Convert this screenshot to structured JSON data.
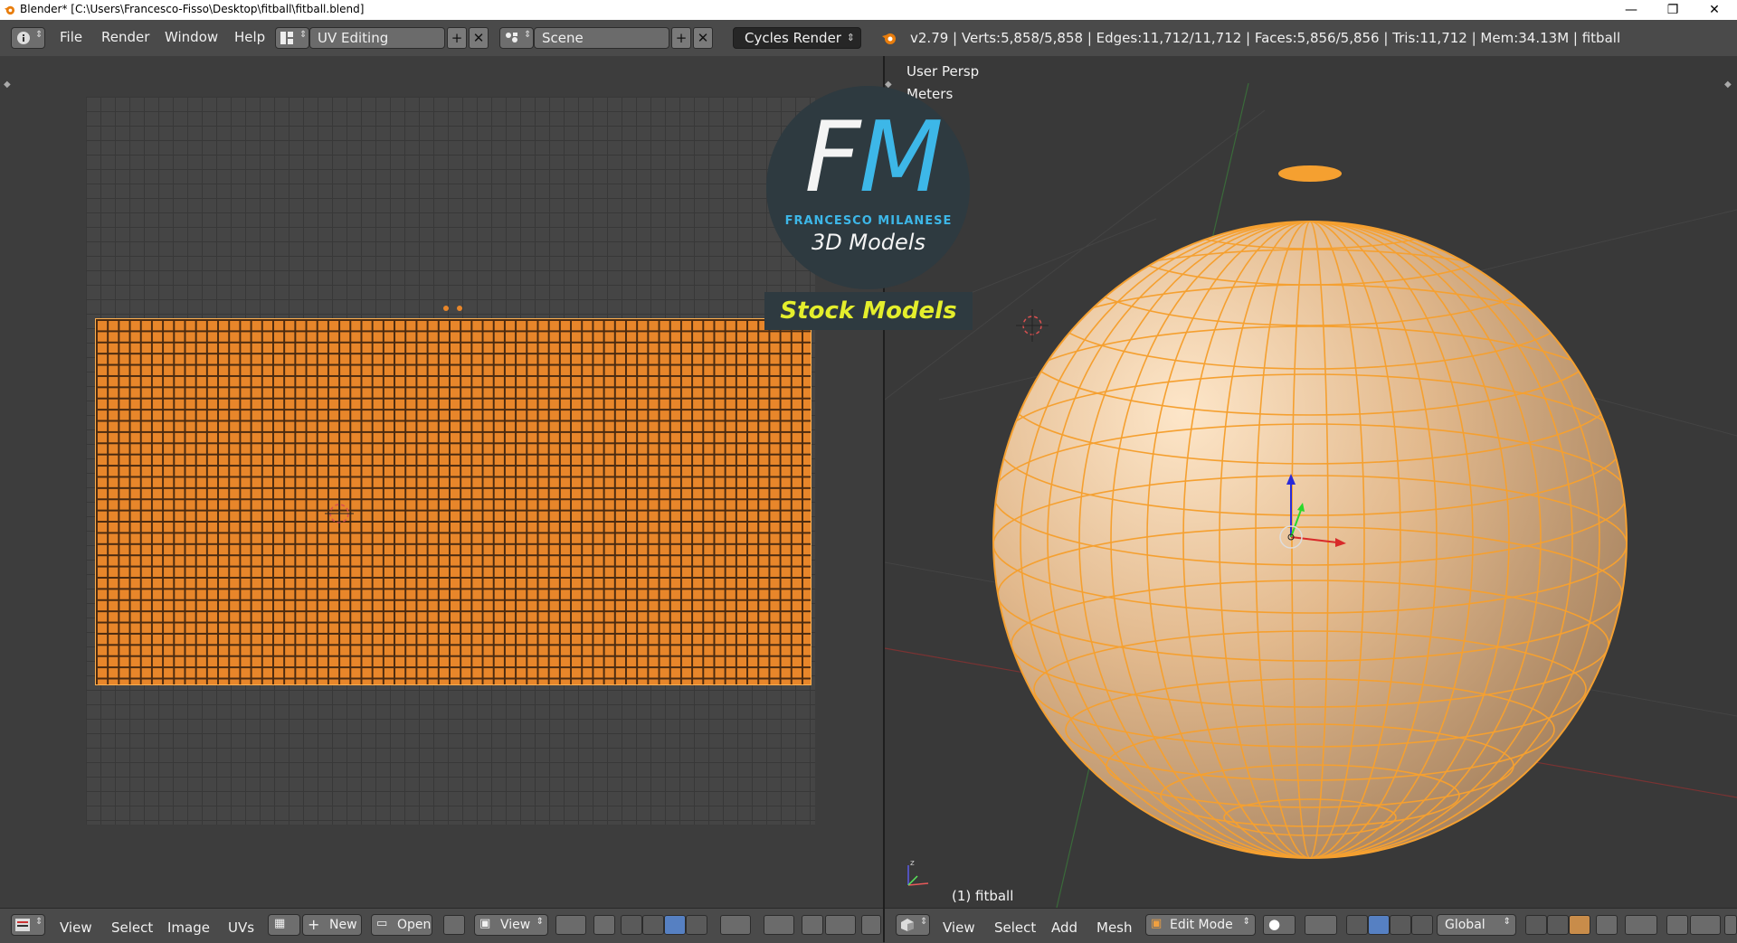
{
  "window": {
    "title": "Blender* [C:\\Users\\Francesco-Fisso\\Desktop\\fitball\\fitball.blend]",
    "minimize": "—",
    "restore": "❐",
    "close": "✕"
  },
  "topbar": {
    "menus": [
      "File",
      "Render",
      "Window",
      "Help"
    ],
    "screen_layout": "UV Editing",
    "scene": "Scene",
    "render_engine": "Cycles Render",
    "stats": "v2.79 | Verts:5,858/5,858 | Edges:11,712/11,712 | Faces:5,856/5,856 | Tris:11,712 | Mem:34.13M | fitball"
  },
  "viewport": {
    "perspective": "User Persp",
    "units": "Meters",
    "object_label": "(1) fitball"
  },
  "logo": {
    "initials_f": "F",
    "initials_m": "M",
    "name": "FRANCESCO MILANESE",
    "subtitle": "3D Models",
    "stock": "Stock Models"
  },
  "uv_footer": {
    "view": "View",
    "select": "Select",
    "image": "Image",
    "uvs": "UVs",
    "new": "New",
    "open": "Open",
    "view2": "View"
  },
  "view3d_footer": {
    "view": "View",
    "select": "Select",
    "add": "Add",
    "mesh": "Mesh",
    "mode": "Edit Mode",
    "orientation": "Global"
  },
  "colors": {
    "accent_orange": "#e8862a",
    "logo_blue": "#3db7e8",
    "logo_yellow": "#e4ee2c"
  }
}
